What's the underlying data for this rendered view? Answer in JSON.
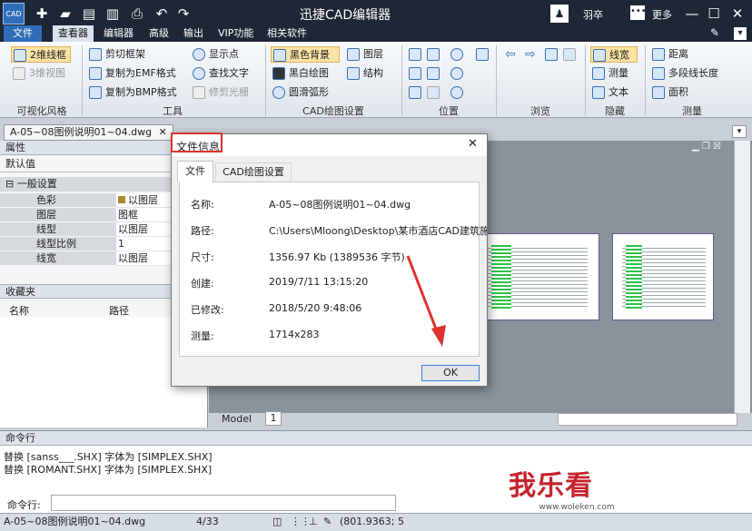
{
  "app": {
    "title": "迅捷CAD编辑器",
    "user": "羽卒",
    "more": "更多",
    "logo": "CAD"
  },
  "menus": [
    "文件",
    "查看器",
    "编辑器",
    "高级",
    "输出",
    "VIP功能",
    "相关软件"
  ],
  "ribbon": {
    "visual": {
      "b1": "2维线框",
      "b2": "3维视图",
      "label": "可视化风格"
    },
    "tools": {
      "b1": "剪切框架",
      "b2": "复制为EMF格式",
      "b3": "复制为BMP格式",
      "b4": "显示点",
      "b5": "查找文字",
      "b6": "修剪光栅",
      "label": "工具"
    },
    "cad": {
      "b1": "黑色背景",
      "b2": "黑白绘图",
      "b3": "圆滑弧形",
      "b4": "图层",
      "b5": "结构",
      "label": "CAD绘图设置"
    },
    "pos": {
      "label": "位置"
    },
    "browse": {
      "label": "浏览"
    },
    "hide": {
      "b1": "线宽",
      "b2": "测量",
      "b3": "文本",
      "label": "隐藏"
    },
    "measure": {
      "b1": "距离",
      "b2": "多段线长度",
      "b3": "面积",
      "label": "测量"
    }
  },
  "doc_tab": "A-05~08图例说明01~04.dwg",
  "props": {
    "header": "属性",
    "default": "默认值",
    "group": "一般设置",
    "rows": [
      {
        "k": "色彩",
        "v": "以图层"
      },
      {
        "k": "图层",
        "v": "图框"
      },
      {
        "k": "线型",
        "v": "以图层"
      },
      {
        "k": "线型比例",
        "v": "1"
      },
      {
        "k": "线宽",
        "v": "以图层"
      }
    ]
  },
  "favorites": {
    "header": "收藏夹",
    "col1": "名称",
    "col2": "路径"
  },
  "canvas_tabs": {
    "model": "Model",
    "one": "1"
  },
  "dialog": {
    "title": "文件信息",
    "tab1": "文件",
    "tab2": "CAD绘图设置",
    "rows": [
      {
        "k": "名称:",
        "v": "A-05~08图例说明01~04.dwg"
      },
      {
        "k": "路径:",
        "v": "C:\\Users\\Mloong\\Desktop\\某市酒店CAD建筑施"
      },
      {
        "k": "尺寸:",
        "v": "1356.97 Kb (1389536 字节)"
      },
      {
        "k": "创建:",
        "v": "2019/7/11 13:15:20"
      },
      {
        "k": "已修改:",
        "v": "2018/5/20 9:48:06"
      },
      {
        "k": "测量:",
        "v": "1714x283"
      }
    ],
    "ok": "OK"
  },
  "command": {
    "header": "命令行",
    "line1": "替换 [sanss___.SHX] 字体为 [SIMPLEX.SHX]",
    "line2": "替换 [ROMANT.SHX] 字体为 [SIMPLEX.SHX]",
    "prompt": "命令行:"
  },
  "status": {
    "file": "A-05~08图例说明01~04.dwg",
    "page": "4/33",
    "coords": "(801.9363; 5"
  },
  "watermark": {
    "text": "我乐看",
    "url": "www.woleken.com"
  },
  "colors": {
    "accent": "#2f6db8",
    "title_bg": "#1e2735",
    "highlight": "#e03030"
  }
}
